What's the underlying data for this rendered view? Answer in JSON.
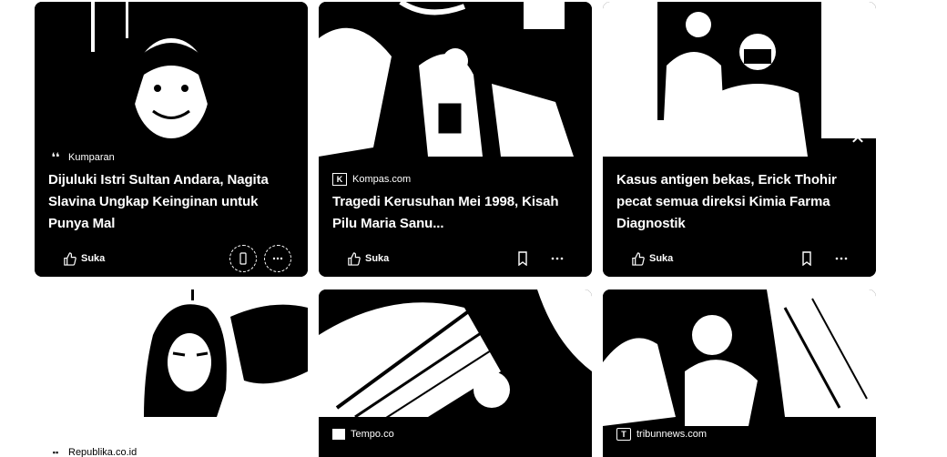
{
  "feed": {
    "cards": [
      {
        "source": "Kumparan",
        "source_icon": "quote-icon",
        "headline": "Dijuluki Istri Sultan Andara, Nagita Slavina Ungkap Keinginan untuk Punya Mal",
        "like_label": "Suka"
      },
      {
        "source": "Kompas.com",
        "source_icon": "kompas-logo-icon",
        "headline": "Tragedi Kerusuhan Mei 1998, Kisah Pilu Maria Sanu...",
        "like_label": "Suka"
      },
      {
        "source": "",
        "source_icon": "",
        "headline": "Kasus antigen bekas, Erick Thohir pecat semua direksi Kimia Farma Diagnostik",
        "like_label": "Suka",
        "close_label": "✕"
      },
      {
        "source": "Republika.co.id",
        "source_icon": "republika-logo-icon"
      },
      {
        "source": "Tempo.co",
        "source_icon": "tempo-logo-icon"
      },
      {
        "source": "tribunnews.com",
        "source_icon": "tribun-logo-icon"
      }
    ]
  }
}
